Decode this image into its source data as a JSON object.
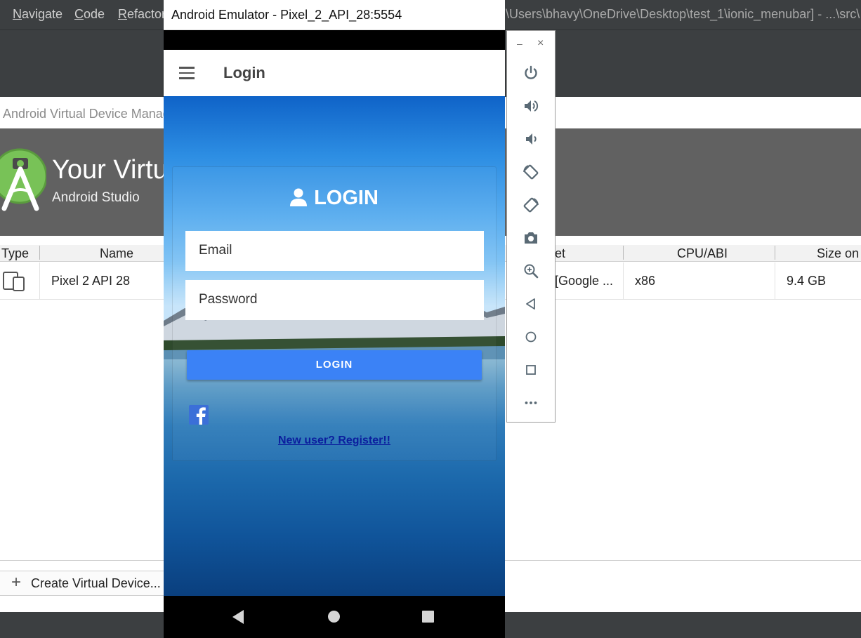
{
  "ide": {
    "menu": [
      {
        "accel": "N",
        "rest": "avigate"
      },
      {
        "accel": "C",
        "rest": "ode"
      },
      {
        "accel": "R",
        "rest": "efactor"
      }
    ],
    "path": "\\Users\\bhavy\\OneDrive\\Desktop\\test_1\\ionic_menubar] - ...\\src\\"
  },
  "avd": {
    "window_title": "Android Virtual Device Manag",
    "heading": "Your Virtu",
    "subheading": "Android Studio",
    "columns": {
      "type": "Type",
      "name": "Name",
      "target": "et",
      "cpu": "CPU/ABI",
      "size": "Size on"
    },
    "device": {
      "name": "Pixel 2 API 28",
      "target": "[Google ...",
      "cpu": "x86",
      "size": "9.4 GB"
    },
    "create_button": "Create Virtual Device..."
  },
  "emulator": {
    "window_title": "Android Emulator - Pixel_2_API_28:5554",
    "minimize_glyph": "–",
    "close_glyph": "×",
    "controls": [
      "power-icon",
      "volume-up-icon",
      "volume-down-icon",
      "rotate-left-icon",
      "rotate-right-icon",
      "camera-icon",
      "zoom-icon",
      "back-icon",
      "home-icon",
      "overview-icon",
      "more-icon"
    ]
  },
  "app": {
    "toolbar_title": "Login",
    "heading": "LOGIN",
    "email_placeholder": "Email",
    "password_placeholder": "Password",
    "login_button": "LOGIN",
    "register_link": "New user? Register!!"
  },
  "colors": {
    "ide_dark": "#3c3f41",
    "avd_banner": "#616161",
    "android_green": "#78c257",
    "login_button": "#3b82f6",
    "facebook": "#3b6fd8",
    "register_link": "#0b1e9e"
  }
}
